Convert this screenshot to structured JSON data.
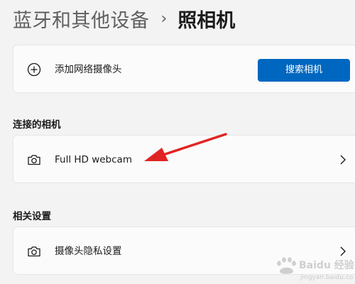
{
  "breadcrumb": {
    "parent": "蓝牙和其他设备",
    "separator": "›",
    "current": "照相机"
  },
  "add_network_camera": {
    "label": "添加网络摄像头",
    "button": "搜索相机",
    "icon": "plus-circle-icon"
  },
  "connected_cameras": {
    "title": "连接的相机",
    "items": [
      {
        "label": "Full HD webcam",
        "icon": "camera-icon"
      }
    ]
  },
  "related_settings": {
    "title": "相关设置",
    "items": [
      {
        "label": "摄像头隐私设置",
        "icon": "camera-icon"
      }
    ]
  },
  "colors": {
    "accent": "#0067c0",
    "annotation_arrow": "#e02424",
    "background": "#f3f3f3",
    "card": "#fbfbfb"
  },
  "watermark": {
    "brand": "Baidu 经验",
    "url": "jingyan.baidu.com"
  }
}
